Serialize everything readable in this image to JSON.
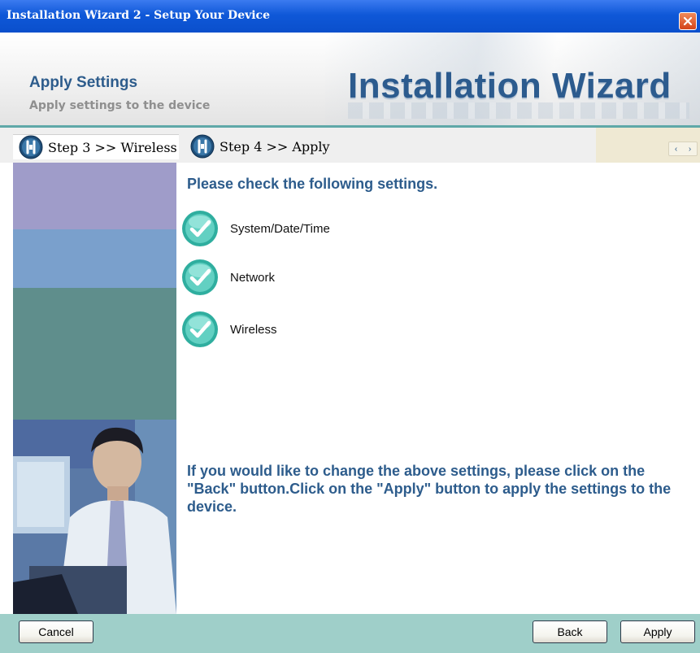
{
  "window": {
    "title": "Installation Wizard 2 - Setup Your Device",
    "close_icon": "close-icon"
  },
  "header": {
    "title": "Apply Settings",
    "subtitle": "Apply settings to the device",
    "brand": "Installation Wizard"
  },
  "steps": [
    {
      "label": "Step 3 >> Wireless",
      "icon": "wrench-icon",
      "active": true
    },
    {
      "label": "Step 4 >> Apply",
      "icon": "wrench-icon",
      "active": false
    }
  ],
  "step_nav": {
    "prev": "‹",
    "next": "›"
  },
  "main": {
    "heading": "Please check the following settings.",
    "items": [
      {
        "label": "System/Date/Time",
        "icon": "checkmark-icon"
      },
      {
        "label": "Network",
        "icon": "checkmark-icon"
      },
      {
        "label": "Wireless",
        "icon": "checkmark-icon"
      }
    ],
    "note": "If you would like to change the above settings, please click on the \"Back\" button.Click on the \"Apply\" button to apply the settings to the device."
  },
  "footer": {
    "cancel": "Cancel",
    "back": "Back",
    "apply": "Apply"
  },
  "colors": {
    "titlebar": "#0f58d8",
    "accent_text": "#2d5c8c",
    "footer": "#9fcfc9",
    "check": "#3dbdb0"
  }
}
